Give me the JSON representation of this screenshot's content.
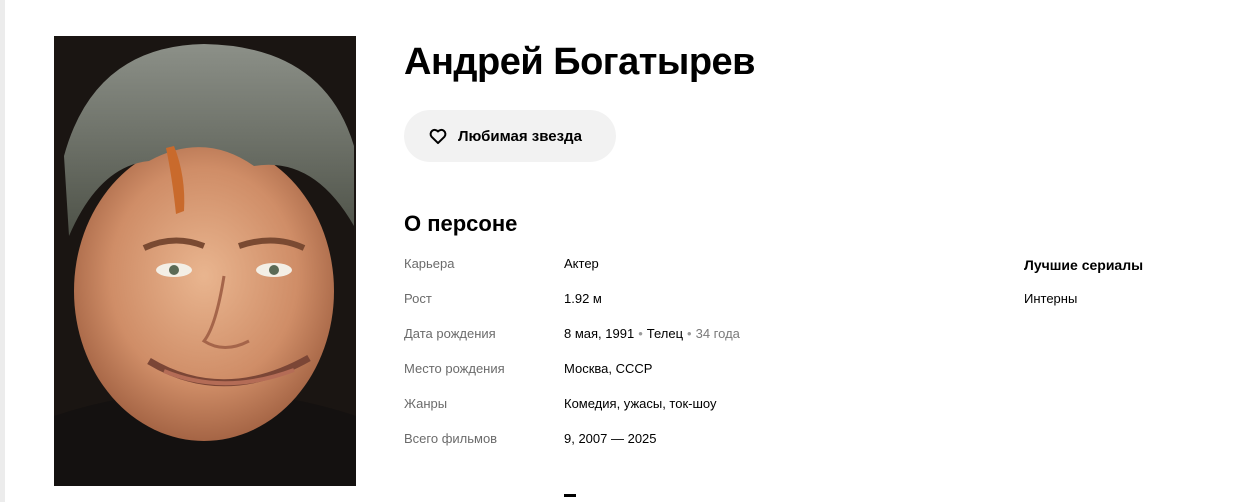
{
  "person": {
    "name": "Андрей Богатырев"
  },
  "actions": {
    "favorite_label": "Любимая звезда"
  },
  "about": {
    "title": "О персоне",
    "rows": [
      {
        "key": "Карьера",
        "value": "Актер"
      },
      {
        "key": "Рост",
        "value": "1.92 м"
      },
      {
        "key": "Дата рождения",
        "value": "8 мая, 1991",
        "sign": "Телец",
        "age": "34 года"
      },
      {
        "key": "Место рождения",
        "value": "Москва, СССР"
      },
      {
        "key": "Жанры",
        "value": "Комедия, ужасы, ток-шоу"
      },
      {
        "key": "Всего фильмов",
        "value": "9, 2007 — 2025"
      }
    ]
  },
  "best_series": {
    "title": "Лучшие сериалы",
    "items": [
      "Интерны"
    ]
  },
  "colors": {
    "button_bg": "#f2f2f2",
    "muted_text": "#6b6b6b"
  }
}
